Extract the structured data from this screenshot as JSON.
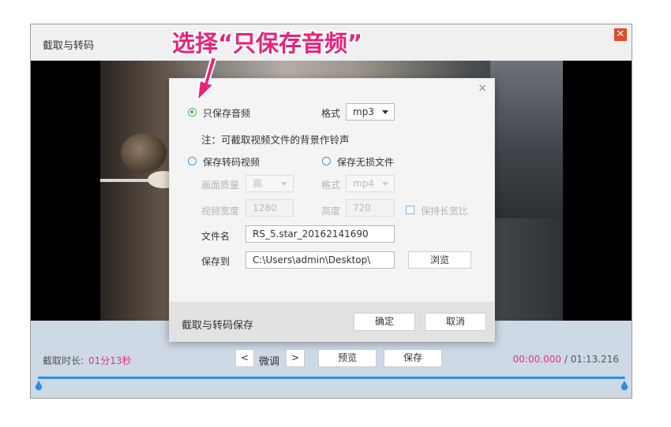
{
  "window": {
    "title": "截取与转码",
    "close_glyph": "✕"
  },
  "callout": "选择“只保存音频”",
  "dialog": {
    "close_glyph": "×",
    "audio_only": {
      "label": "只保存音频",
      "checked": true,
      "format_label": "格式",
      "format_value": "mp3"
    },
    "note": "注：可截取视频文件的背景作铃声",
    "transcode_video": {
      "label": "保存转码视频",
      "checked": false
    },
    "lossless": {
      "label": "保存无损文件",
      "checked": false
    },
    "quality": {
      "label": "画面质量",
      "value": "高"
    },
    "video_format": {
      "label": "格式",
      "value": "mp4"
    },
    "width": {
      "label": "视频宽度",
      "value": "1280"
    },
    "height": {
      "label": "高度",
      "value": "720"
    },
    "keep_ratio": {
      "label": "保持长宽比",
      "checked": false
    },
    "filename": {
      "label": "文件名",
      "value": "RS_5.star_20162141690"
    },
    "save_to": {
      "label": "保存到",
      "value": "C:\\Users\\admin\\Desktop\\"
    },
    "browse_label": "浏览",
    "footer_title": "截取与转码保存",
    "ok_label": "确定",
    "cancel_label": "取消"
  },
  "controls": {
    "duration_label": "截取时长:",
    "duration_value": "01分13秒",
    "prev_glyph": "<",
    "fine_tune_label": "微调",
    "next_glyph": ">",
    "preview_label": "预览",
    "save_label": "保存",
    "current_time": "00:00.000",
    "separator": "/",
    "total_time": "01:13.216"
  },
  "colors": {
    "accent": "#e0357a",
    "track": "#2e8fe0",
    "close_red": "#e04b2a",
    "callout": "#e8237a"
  }
}
